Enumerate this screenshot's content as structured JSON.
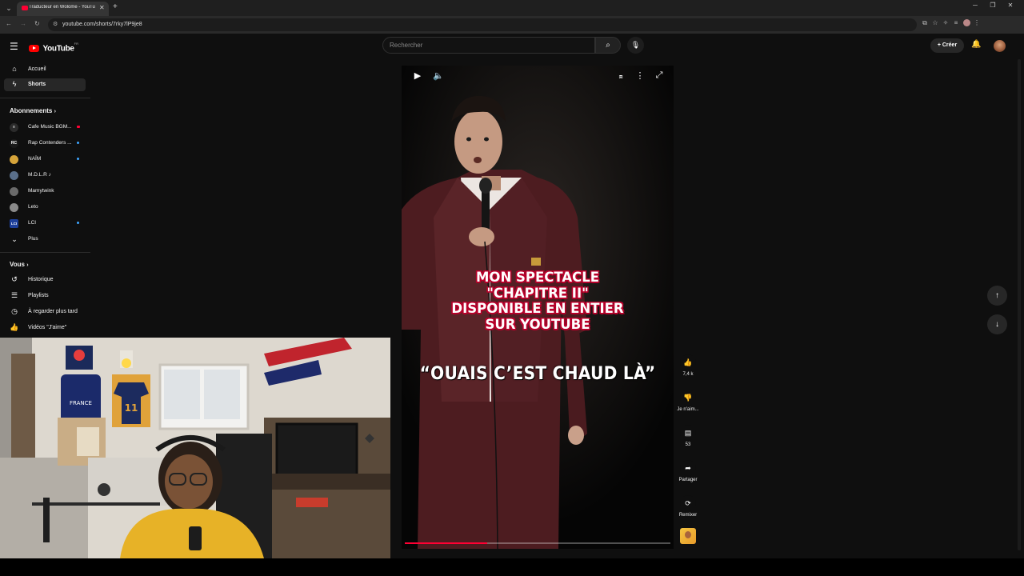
{
  "browser": {
    "tab_title": "Traducteur en Wolfoolme - YouTube",
    "tab_title_display": "Traducteur en Wolome - YouTu",
    "url": "youtube.com/shorts/7rky7lP9je8"
  },
  "header": {
    "logo_text": "YouTube",
    "logo_sup": "FR",
    "search_placeholder": "Rechercher",
    "create_label": "Créer"
  },
  "sidebar": {
    "main": [
      {
        "label": "Accueil",
        "icon": "home-icon"
      },
      {
        "label": "Shorts",
        "icon": "shorts-icon"
      }
    ],
    "subscriptions_title": "Abonnements",
    "subscriptions": [
      {
        "label": "Cafe Music BGM...",
        "avatar": "",
        "color": "#2b2b2b"
      },
      {
        "label": "Rap Contenders ...",
        "avatar": "RC",
        "color": "#1a1a1a"
      },
      {
        "label": "NAÏM",
        "avatar": "",
        "color": "#d6a43a"
      },
      {
        "label": "M.D.L.R ♪",
        "avatar": "",
        "color": "#5a6f8a"
      },
      {
        "label": "Mamytwink",
        "avatar": "",
        "color": "#6a6a6a"
      },
      {
        "label": "Leto",
        "avatar": "",
        "color": "#8a8a8a"
      },
      {
        "label": "LCI",
        "avatar": "LCI",
        "color": "#1d3f9a"
      },
      {
        "label": "Plus",
        "avatar": "",
        "color": ""
      }
    ],
    "you_title": "Vous",
    "you_items": [
      {
        "label": "Historique",
        "icon": "history-icon"
      },
      {
        "label": "Playlists",
        "icon": "playlists-icon"
      },
      {
        "label": "À regarder plus tard",
        "icon": "watch-later-icon"
      },
      {
        "label": "Vidéos \"J'aime\"",
        "icon": "liked-icon"
      }
    ]
  },
  "video": {
    "caption_lines": [
      "MON SPECTACLE",
      "\"CHAPITRE II\"",
      "DISPONIBLE EN ENTIER",
      "SUR YOUTUBE"
    ],
    "quote": "“OUAIS C’EST CHAUD LÀ”",
    "progress": 0.31
  },
  "actions": {
    "likes": "7,4 k",
    "dislike_label": "Je n'aim...",
    "comments": "53",
    "share_label": "Partager",
    "remix_label": "Remixer"
  },
  "colors": {
    "accent": "#ff0033",
    "caption_outline": "#b8002a",
    "background": "#0f0f0f"
  }
}
